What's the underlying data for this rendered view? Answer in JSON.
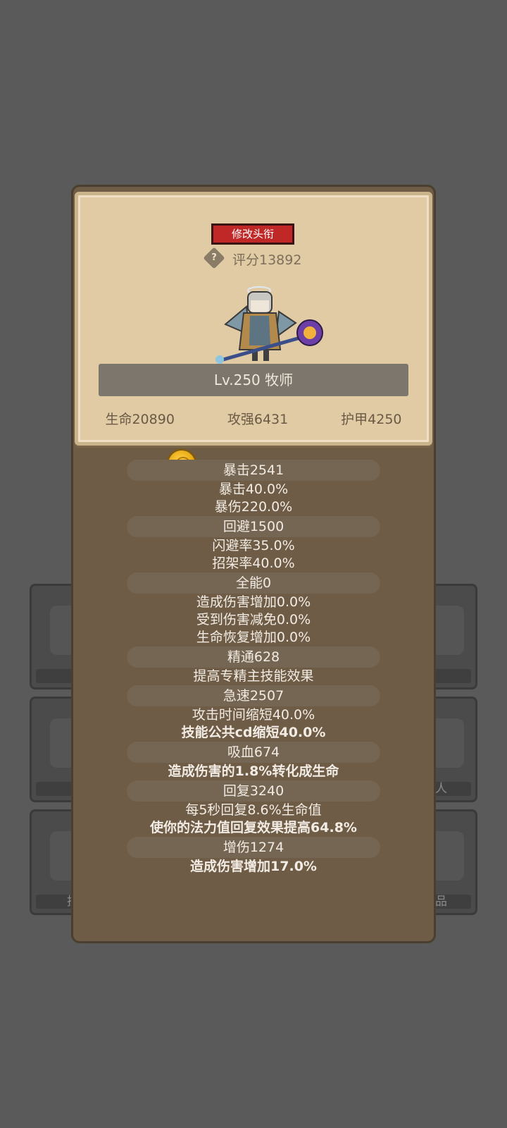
{
  "slots_left": [
    "",
    "",
    "技"
  ],
  "slots_right": [
    "",
    "人",
    "品"
  ],
  "card": {
    "title_button": "修改头衔",
    "help_icon": "?",
    "score": "评分13892",
    "level_class": "Lv.250 牧师",
    "base_stats": [
      "生命20890",
      "攻强6431",
      "护甲4250"
    ]
  },
  "stat_sections": [
    {
      "header": "暴击2541",
      "lines": [
        "暴击40.0%",
        "暴伤220.0%"
      ]
    },
    {
      "header": "回避1500",
      "lines": [
        "闪避率35.0%",
        "招架率40.0%"
      ]
    },
    {
      "header": "全能0",
      "lines": [
        "造成伤害增加0.0%",
        "受到伤害减免0.0%",
        "生命恢复增加0.0%"
      ]
    },
    {
      "header": "精通628",
      "lines": [
        "提高专精主技能效果"
      ]
    },
    {
      "header": "急速2507",
      "lines": [
        "攻击时间缩短40.0%",
        "技能公共cd缩短40.0%"
      ]
    },
    {
      "header": "吸血674",
      "lines": [
        "造成伤害的1.8%转化成生命"
      ]
    },
    {
      "header": "回复3240",
      "lines": [
        "每5秒回复8.6%生命值",
        "使你的法力值回复效果提高64.8%"
      ]
    },
    {
      "header": "增伤1274",
      "lines": [
        "造成伤害增加17.0%"
      ]
    }
  ]
}
